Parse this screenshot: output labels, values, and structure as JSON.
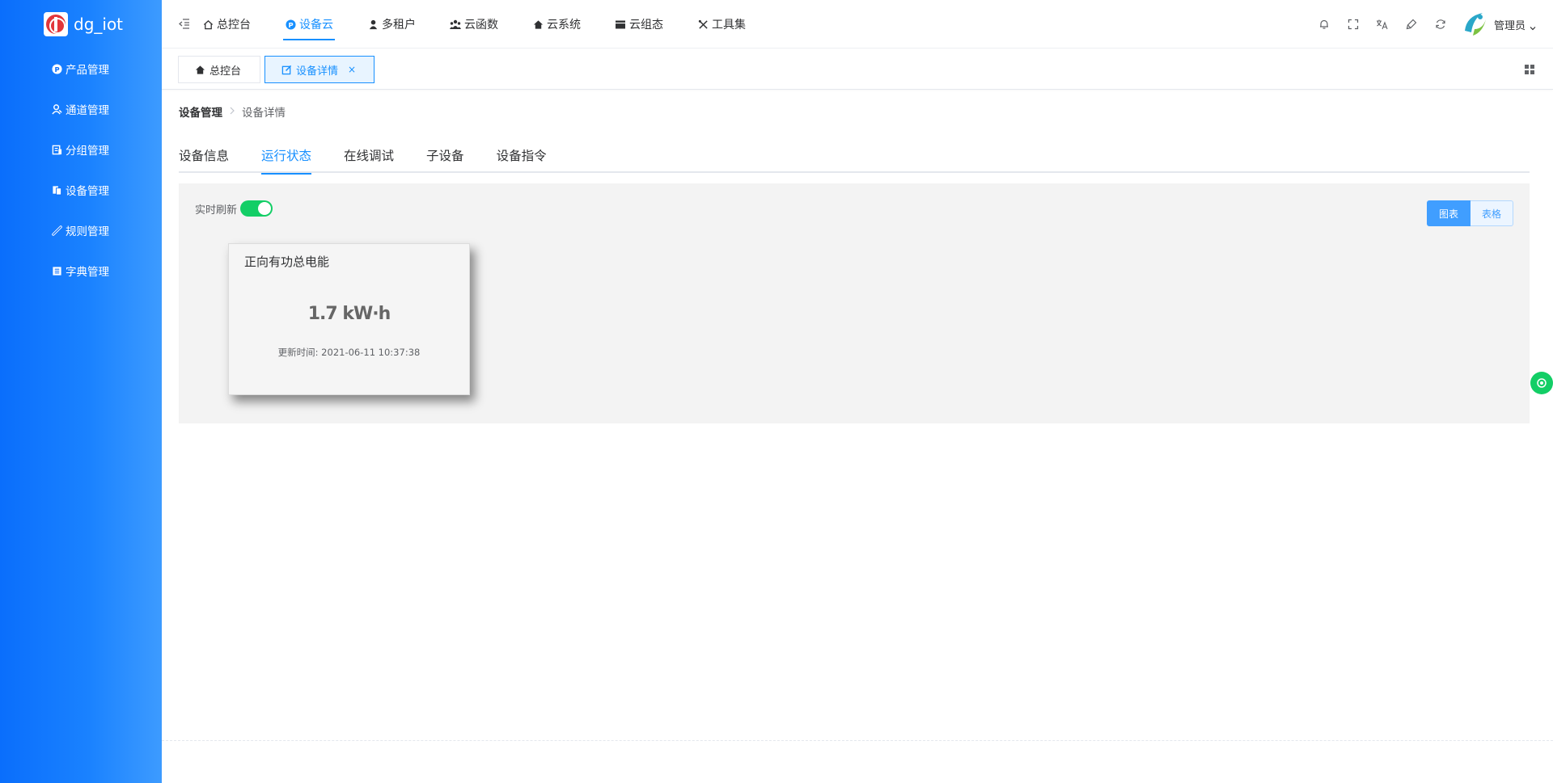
{
  "app": {
    "name": "dg_iot"
  },
  "sidebar": {
    "items": [
      {
        "label": "产品管理",
        "icon": "product-icon"
      },
      {
        "label": "通道管理",
        "icon": "channel-icon"
      },
      {
        "label": "分组管理",
        "icon": "group-icon"
      },
      {
        "label": "设备管理",
        "icon": "device-icon"
      },
      {
        "label": "规则管理",
        "icon": "rule-icon"
      },
      {
        "label": "字典管理",
        "icon": "dictionary-icon"
      }
    ]
  },
  "topnav": {
    "items": [
      {
        "label": "总控台",
        "icon": "home-icon",
        "active": false
      },
      {
        "label": "设备云",
        "icon": "device-cloud-icon",
        "active": true
      },
      {
        "label": "多租户",
        "icon": "tenant-icon",
        "active": false
      },
      {
        "label": "云函数",
        "icon": "function-icon",
        "active": false
      },
      {
        "label": "云系统",
        "icon": "system-icon",
        "active": false
      },
      {
        "label": "云组态",
        "icon": "config-icon",
        "active": false
      },
      {
        "label": "工具集",
        "icon": "tools-icon",
        "active": false
      }
    ],
    "user": "管理员"
  },
  "tags": [
    {
      "label": "总控台",
      "icon": "home-icon",
      "active": false
    },
    {
      "label": "设备详情",
      "icon": "edit-icon",
      "active": true,
      "close": "×"
    }
  ],
  "breadcrumb": {
    "first": "设备管理",
    "current": "设备详情"
  },
  "tabs": [
    {
      "label": "设备信息",
      "active": false
    },
    {
      "label": "运行状态",
      "active": true
    },
    {
      "label": "在线调试",
      "active": false
    },
    {
      "label": "子设备",
      "active": false
    },
    {
      "label": "设备指令",
      "active": false
    }
  ],
  "panel": {
    "refresh_label": "实时刷新",
    "refresh_on": true,
    "view_chart": "图表",
    "view_table": "表格"
  },
  "card": {
    "title": "正向有功总电能",
    "value": "1.7 kW·h",
    "updated": "更新时间: 2021-06-11 10:37:38"
  },
  "colors": {
    "primary": "#1890ff",
    "sidebar": "#0a6efc",
    "success": "#13ce66"
  }
}
